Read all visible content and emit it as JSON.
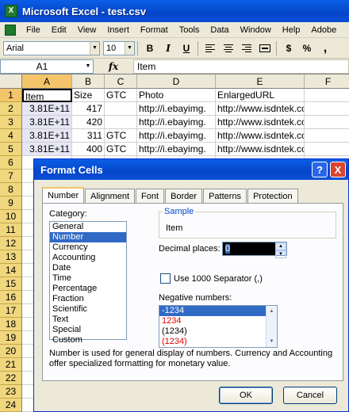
{
  "window": {
    "title": "Microsoft Excel - test.csv",
    "app_icon": "X"
  },
  "menu": [
    "File",
    "Edit",
    "View",
    "Insert",
    "Format",
    "Tools",
    "Data",
    "Window",
    "Help",
    "Adobe"
  ],
  "toolbar": {
    "font": "Arial",
    "size": "10",
    "bold": "B",
    "italic": "I",
    "underline": "U",
    "currency": "$",
    "percent": "%",
    "comma": ","
  },
  "formula_bar": {
    "name_box": "A1",
    "fx": "fx",
    "content": "Item"
  },
  "columns": [
    "A",
    "B",
    "C",
    "D",
    "E",
    "F"
  ],
  "rows": [
    "1",
    "2",
    "3",
    "4",
    "5",
    "6",
    "7",
    "8",
    "9",
    "10",
    "11",
    "12",
    "13",
    "14",
    "15",
    "16",
    "17",
    "18",
    "19",
    "20",
    "21",
    "22",
    "23",
    "24"
  ],
  "cells": [
    [
      "Item",
      "Size",
      "GTC",
      "Photo",
      "EnlargedURL"
    ],
    [
      "3.81E+11",
      "417",
      "",
      "http://i.ebayimg.",
      "http://www.isdntek.com/imag"
    ],
    [
      "3.81E+11",
      "420",
      "",
      "http://i.ebayimg.",
      "http://www.isdntek.com/imag"
    ],
    [
      "3.81E+11",
      "311",
      "GTC",
      "http://i.ebayimg.",
      "http://www.isdntek.com/imag"
    ],
    [
      "3.81E+11",
      "400",
      "GTC",
      "http://i.ebayimg.",
      "http://www.isdntek.com/imag"
    ]
  ],
  "dialog": {
    "title": "Format Cells",
    "help": "?",
    "close": "X",
    "tabs": [
      "Number",
      "Alignment",
      "Font",
      "Border",
      "Patterns",
      "Protection"
    ],
    "category_label": "Category:",
    "categories": [
      "General",
      "Number",
      "Currency",
      "Accounting",
      "Date",
      "Time",
      "Percentage",
      "Fraction",
      "Scientific",
      "Text",
      "Special",
      "Custom"
    ],
    "selected_category": "Number",
    "sample_label": "Sample",
    "sample_value": "Item",
    "decimal_label": "Decimal places:",
    "decimal_value": "0",
    "separator_label": "Use 1000 Separator (,)",
    "negative_label": "Negative numbers:",
    "negative_options": [
      "-1234",
      "1234",
      "(1234)",
      "(1234)"
    ],
    "description": "Number is used for general display of numbers.  Currency and Accounting offer specialized formatting for monetary value.",
    "ok": "OK",
    "cancel": "Cancel"
  }
}
